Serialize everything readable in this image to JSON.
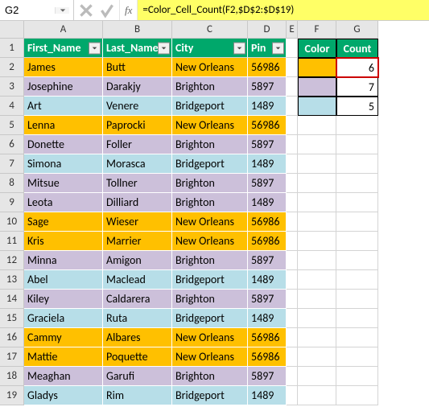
{
  "activeCell": "G2",
  "formula": "=Color_Cell_Count(F2,$D$2:$D$19)",
  "fxLabel": "fx",
  "columns": [
    "A",
    "B",
    "C",
    "D",
    "E",
    "F",
    "G"
  ],
  "rowCount": 19,
  "tableHeaders": {
    "a": "First_Name",
    "b": "Last_Name",
    "c": "City",
    "d": "Pin"
  },
  "sideHeaders": {
    "f": "Color",
    "g": "Count"
  },
  "rows": [
    {
      "first": "James",
      "last": "Butt",
      "city": "New Orleans",
      "pin": "56986",
      "color": "orange"
    },
    {
      "first": "Josephine",
      "last": "Darakjy",
      "city": "Brighton",
      "pin": "5897",
      "color": "purple"
    },
    {
      "first": "Art",
      "last": "Venere",
      "city": "Bridgeport",
      "pin": "1489",
      "color": "blue"
    },
    {
      "first": "Lenna",
      "last": "Paprocki",
      "city": "New Orleans",
      "pin": "56986",
      "color": "orange"
    },
    {
      "first": "Donette",
      "last": "Foller",
      "city": "Brighton",
      "pin": "5897",
      "color": "purple"
    },
    {
      "first": "Simona",
      "last": "Morasca",
      "city": "Bridgeport",
      "pin": "1489",
      "color": "blue"
    },
    {
      "first": "Mitsue",
      "last": "Tollner",
      "city": "Brighton",
      "pin": "5897",
      "color": "purple"
    },
    {
      "first": "Leota",
      "last": "Dilliard",
      "city": "Brighton",
      "pin": "1489",
      "color": "purple"
    },
    {
      "first": "Sage",
      "last": "Wieser",
      "city": "New Orleans",
      "pin": "56986",
      "color": "orange"
    },
    {
      "first": "Kris",
      "last": "Marrier",
      "city": "New Orleans",
      "pin": "56986",
      "color": "orange"
    },
    {
      "first": "Minna",
      "last": "Amigon",
      "city": "Brighton",
      "pin": "5897",
      "color": "purple"
    },
    {
      "first": "Abel",
      "last": "Maclead",
      "city": "Bridgeport",
      "pin": "1489",
      "color": "blue"
    },
    {
      "first": "Kiley",
      "last": "Caldarera",
      "city": "Brighton",
      "pin": "5897",
      "color": "purple"
    },
    {
      "first": "Graciela",
      "last": "Ruta",
      "city": "Bridgeport",
      "pin": "1489",
      "color": "blue"
    },
    {
      "first": "Cammy",
      "last": "Albares",
      "city": "New Orleans",
      "pin": "56986",
      "color": "orange"
    },
    {
      "first": "Mattie",
      "last": "Poquette",
      "city": "New Orleans",
      "pin": "56986",
      "color": "orange"
    },
    {
      "first": "Meaghan",
      "last": "Garufi",
      "city": "Brighton",
      "pin": "5897",
      "color": "purple"
    },
    {
      "first": "Gladys",
      "last": "Rim",
      "city": "Bridgeport",
      "pin": "1489",
      "color": "blue"
    }
  ],
  "sideTable": [
    {
      "colorClass": "orange",
      "count": "6",
      "selected": true
    },
    {
      "colorClass": "purple",
      "count": "7",
      "selected": false
    },
    {
      "colorClass": "blue",
      "count": "5",
      "selected": false
    }
  ],
  "colors": {
    "orange": "#ffc000",
    "purple": "#ccc0da",
    "blue": "#b7dee8",
    "headerGreen": "#00a86b",
    "highlight": "#ffff66"
  }
}
